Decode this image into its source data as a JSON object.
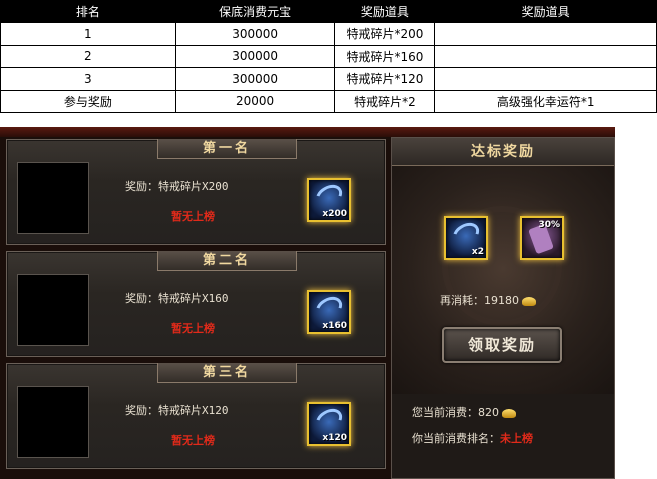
{
  "table": {
    "headers": [
      "排名",
      "保底消费元宝",
      "奖励道具",
      "奖励道具"
    ],
    "rows": [
      [
        "1",
        "300000",
        "特戒碎片*200",
        ""
      ],
      [
        "2",
        "300000",
        "特戒碎片*160",
        ""
      ],
      [
        "3",
        "300000",
        "特戒碎片*120",
        ""
      ],
      [
        "参与奖励",
        "20000",
        "特戒碎片*2",
        "高级强化幸运符*1"
      ]
    ]
  },
  "ranks": [
    {
      "title": "第一名",
      "reward_label": "奖励：",
      "reward_value": "特戒碎片X200",
      "status": "暂无上榜",
      "qty": "x200"
    },
    {
      "title": "第二名",
      "reward_label": "奖励：",
      "reward_value": "特戒碎片X160",
      "status": "暂无上榜",
      "qty": "x160"
    },
    {
      "title": "第三名",
      "reward_label": "奖励：",
      "reward_value": "特戒碎片X120",
      "status": "暂无上榜",
      "qty": "x120"
    }
  ],
  "side": {
    "title": "达标奖励",
    "item_a_qty": "x2",
    "item_b_pct": "30%",
    "cost_label": "再消耗：",
    "cost_value": "19180",
    "claim_button": "领取奖励",
    "my_spend_label": "您当前消费：",
    "my_spend_value": "820",
    "my_rank_label": "你当前消费排名：",
    "my_rank_value": "未上榜"
  },
  "icons": {
    "shard": "ring-shard-icon",
    "scroll": "luck-charm-icon",
    "gold": "gold-ingot-icon"
  },
  "colors": {
    "status_red": "#e02a1a",
    "gold_border": "#e8c030",
    "title_text": "#f0d8a0"
  }
}
